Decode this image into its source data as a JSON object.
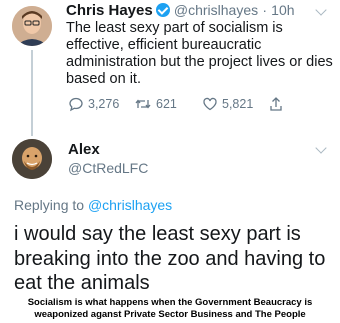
{
  "original_tweet": {
    "name": "Chris Hayes",
    "handle": "@chrislhayes",
    "separator": "·",
    "time": "10h",
    "text": "The least sexy part of socialism is effective, efficient bureaucratic administration but the project lives or dies based on it.",
    "actions": {
      "replies": "3,276",
      "retweets": "621",
      "likes": "5,821"
    }
  },
  "reply_tweet": {
    "name": "Alex",
    "handle": "@CtRedLFC",
    "replying_prefix": "Replying to",
    "replying_to": "@chrislhayes",
    "text": "i would say the least sexy part is breaking into the zoo and having to eat the animals"
  },
  "caption": {
    "line1": "Socialism is what happens when the Government Beaucracy is",
    "line2": "weaponized aganst Private Sector Business and The People"
  },
  "colors": {
    "accent": "#1da1f2",
    "muted": "#657786",
    "text": "#14171a"
  }
}
